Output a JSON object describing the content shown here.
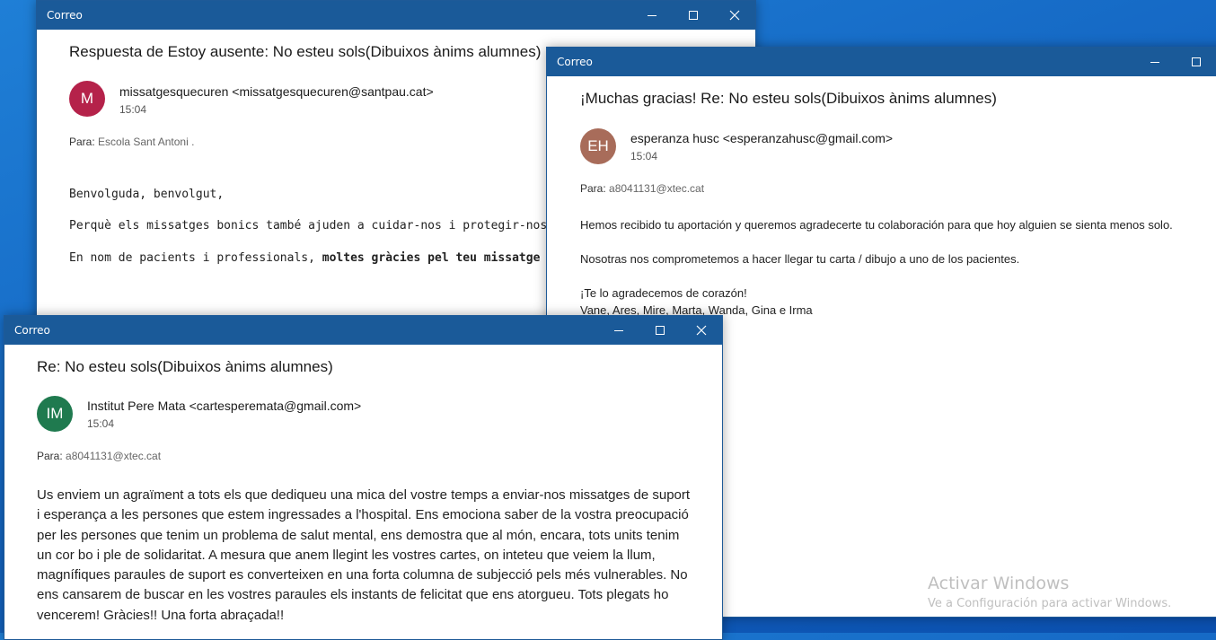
{
  "window1": {
    "title": "Correo",
    "subject": "Respuesta de Estoy ausente: No esteu sols(Dibuixos ànims alumnes)",
    "avatar_initials": "M",
    "avatar_color": "#b5224a",
    "sender": "missatgesquecuren <missatgesquecuren@santpau.cat>",
    "time": "15:04",
    "to_label": "Para:",
    "to_value": "Escola Sant Antoni .",
    "greeting": "Benvolguda, benvolgut,",
    "line1": "Perquè els missatges bonics també ajuden a cuidar-nos i protegir-nos.",
    "line2_prefix": "En nom de pacients i professionals, ",
    "line2_bold": "moltes gràcies pel teu missatge !!!!"
  },
  "window2": {
    "title": "Correo",
    "subject": "¡Muchas gracias! Re: No esteu sols(Dibuixos ànims alumnes)",
    "avatar_initials": "EH",
    "avatar_color": "#a86c5a",
    "sender": "esperanza husc <esperanzahusc@gmail.com>",
    "time": "15:04",
    "to_label": "Para:",
    "to_value": "a8041131@xtec.cat",
    "line1": "Hemos recibido tu aportación y queremos agradecerte tu colaboración para que hoy alguien se sienta menos solo.",
    "line2": "Nosotras nos comprometemos a hacer llegar tu carta / dibujo a uno de los pacientes.",
    "line3": "¡Te lo agradecemos de corazón!",
    "line4": "Vane, Ares, Mire, Marta, Wanda, Gina e Irma"
  },
  "window3": {
    "title": "Correo",
    "subject": "Re: No esteu sols(Dibuixos ànims alumnes)",
    "avatar_initials": "IM",
    "avatar_color": "#1f7a4f",
    "sender": "Institut Pere Mata <cartesperemata@gmail.com>",
    "time": "15:04",
    "to_label": "Para:",
    "to_value": "a8041131@xtec.cat",
    "body": "Us enviem un agraïment a tots els que dediqueu una mica del vostre temps a enviar-nos missatges de suport i esperança a les persones que estem ingressades a l'hospital. Ens emociona saber de la vostra preocupació per les persones que tenim un problema de salut mental, ens demostra que al món, encara, tots units tenim un cor bo i ple de solidaritat. A mesura que anem llegint les vostres cartes, on inteteu que veiem la llum, magnífiques paraules de suport es converteixen en una forta columna de subjecció pels més vulnerables. No ens cansarem de buscar en les vostres paraules els instants de felicitat que ens atorgueu. Tots plegats ho vencerem! Gràcies!! Una forta abraçada!!"
  },
  "watermark": {
    "line1": "Activar Windows",
    "line2": "Ve a Configuración para activar Windows."
  }
}
